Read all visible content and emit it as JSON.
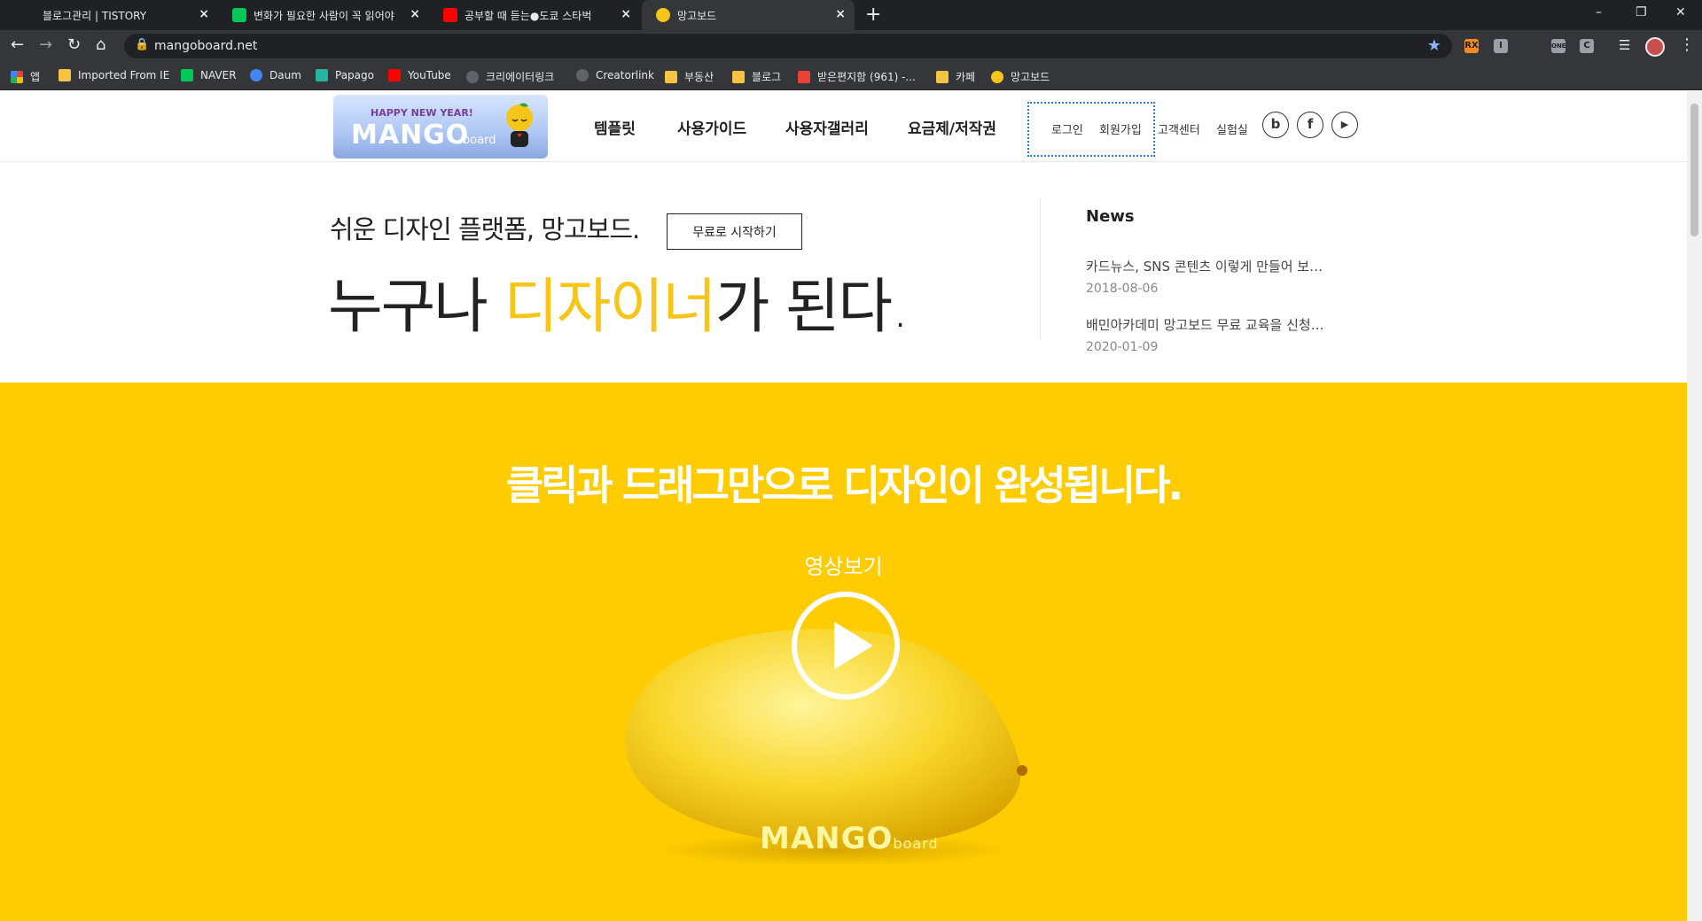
{
  "browser": {
    "tabs": [
      {
        "label": "블로그관리 | TISTORY",
        "active": false
      },
      {
        "label": "변화가 필요한 사람이 꼭 읽어야",
        "active": false
      },
      {
        "label": "공부할 때 듣는●도쿄 스타벅",
        "active": false
      },
      {
        "label": "망고보드",
        "active": true
      }
    ],
    "tab_close": "×",
    "new_tab": "+",
    "window_controls": {
      "minimize": "–",
      "restore": "❐",
      "close": "✕"
    },
    "nav": {
      "back": "←",
      "forward": "→",
      "reload": "↻",
      "home": "⌂"
    },
    "url": "mangoboard.net",
    "extensions": [
      "RX",
      "I",
      "ONE",
      "C"
    ],
    "bookmarks": [
      {
        "label": "앱",
        "color": "#ea4335"
      },
      {
        "label": "Imported From IE",
        "color": "#f6c343"
      },
      {
        "label": "NAVER",
        "color": "#03c75a"
      },
      {
        "label": "Daum",
        "color": "#4285f4"
      },
      {
        "label": "Papago",
        "color": "#28b4a3"
      },
      {
        "label": "YouTube",
        "color": "#ff0000"
      },
      {
        "label": "크리에이터링크",
        "color": "#5f6368"
      },
      {
        "label": "Creatorlink",
        "color": "#5f6368"
      },
      {
        "label": "부동산",
        "color": "#f6c343"
      },
      {
        "label": "블로그",
        "color": "#f6c343"
      },
      {
        "label": "받은편지함 (961) -...",
        "color": "#ea4335"
      },
      {
        "label": "카페",
        "color": "#f6c343"
      },
      {
        "label": "망고보드",
        "color": "#f5c518"
      }
    ]
  },
  "site": {
    "logo": {
      "tagline": "HAPPY NEW YEAR!",
      "word": "MANGO",
      "suffix": "board"
    },
    "main_nav": [
      "템플릿",
      "사용가이드",
      "사용자갤러리",
      "요금제/저작권"
    ],
    "util_nav": [
      "로그인",
      "회원가입",
      "고객센터",
      "실험실"
    ],
    "social": [
      "b",
      "f",
      "▶"
    ],
    "hero": {
      "small_headline": "쉬운 디자인 플랫폼, 망고보드.",
      "start_button": "무료로 시작하기",
      "big_pre": "누구나 ",
      "big_accent": "디자이너",
      "big_post": "가 된다."
    },
    "news": {
      "title": "News",
      "items": [
        {
          "title": "카드뉴스, SNS 콘텐츠 이렇게 만들어 보…",
          "date": "2018-08-06"
        },
        {
          "title": "배민아카데미 망고보드 무료 교육을 신청…",
          "date": "2020-01-09"
        }
      ]
    },
    "promo": {
      "title": "클릭과 드래그만으로 디자인이 완성됩니다.",
      "video_label": "영상보기",
      "brand_word": "MANGO",
      "brand_suffix": "board"
    },
    "colors": {
      "accent": "#f5c518",
      "yellow_bg": "#fecc00"
    }
  }
}
